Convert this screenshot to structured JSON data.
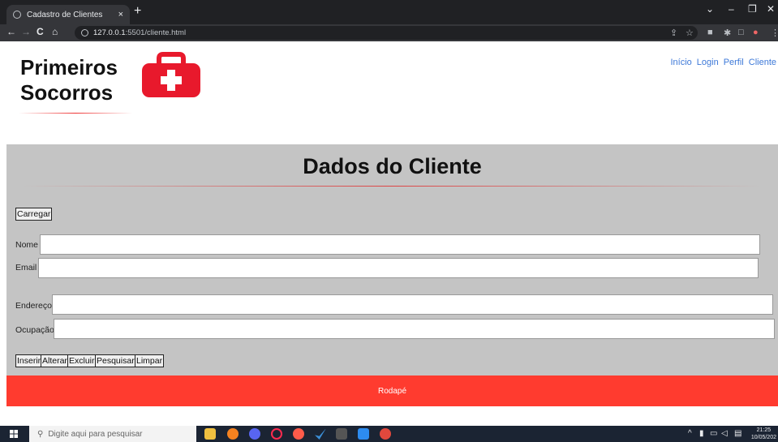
{
  "browser": {
    "tab_title": "Cadastro de Clientes",
    "tab_close": "×",
    "new_tab": "+",
    "minimize": "⌄",
    "min": "–",
    "restore": "❐",
    "close": "✕",
    "back": "←",
    "forward": "→",
    "reload": "C",
    "home": "⌂",
    "url_host": "127.0.0.1",
    "url_path": ":5501/cliente.html",
    "icons": [
      "share-icon",
      "star-icon",
      "extension-icon",
      "puzzle-icon",
      "sidebar-icon",
      "profile-icon",
      "menu-icon"
    ]
  },
  "header": {
    "logo_line1": "Primeiros",
    "logo_line2": "Socorros",
    "nav": [
      "Início",
      "Login",
      "Perfil",
      "Cliente"
    ]
  },
  "main": {
    "title": "Dados do Cliente",
    "load_button": "Carregar",
    "fields": {
      "nome": {
        "label": "Nome",
        "value": ""
      },
      "email": {
        "label": "Email",
        "value": ""
      },
      "endereco": {
        "label": "Endereço",
        "value": ""
      },
      "ocupacao": {
        "label": "Ocupação",
        "value": ""
      }
    },
    "actions": [
      "Inserir",
      "Alterar",
      "Excluir",
      "Pesquisar",
      "Limpar"
    ]
  },
  "footer": {
    "text": "Rodapé"
  },
  "taskbar": {
    "search_placeholder": "Digite aqui para pesquisar",
    "clock_time": "21:25",
    "clock_date": "10/05/202"
  },
  "colors": {
    "footer": "#ff3b2f",
    "main_bg": "#c4c4c4",
    "nav_link": "#3c78d8",
    "kit_red": "#e8192c"
  }
}
